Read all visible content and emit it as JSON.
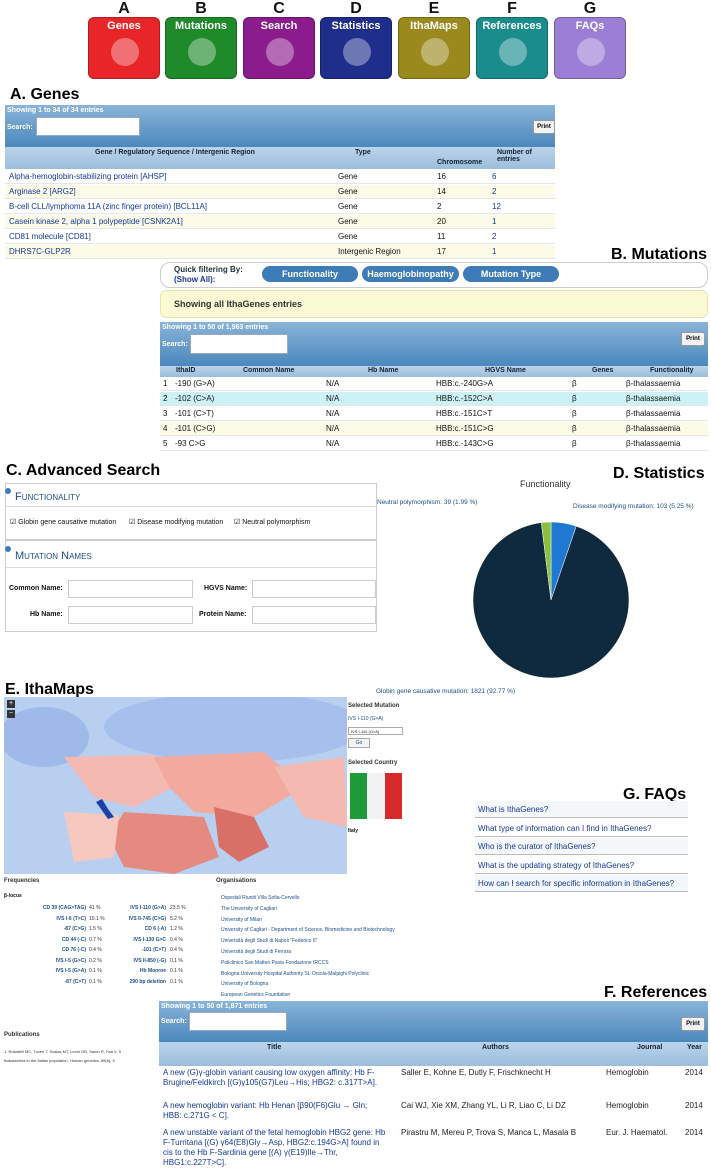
{
  "tiles": [
    {
      "letter": "A",
      "label": "Genes",
      "color": "#e8262a"
    },
    {
      "letter": "B",
      "label": "Mutations",
      "color": "#1f8a2a"
    },
    {
      "letter": "C",
      "label": "Search",
      "color": "#8b1c8c"
    },
    {
      "letter": "D",
      "label": "Statistics",
      "color": "#1e2e8a"
    },
    {
      "letter": "E",
      "label": "IthaMaps",
      "color": "#9a8a1e"
    },
    {
      "letter": "F",
      "label": "References",
      "color": "#1a8c8c"
    },
    {
      "letter": "G",
      "label": "FAQs",
      "color": "#9b7ed6"
    }
  ],
  "genes": {
    "title": "A. Genes",
    "info": "Showing 1 to 34 of 34 entries",
    "search_label": "Search:",
    "print": "Print",
    "headers": [
      "Gene / Regulatory Sequence / Intergenic Region",
      "Type",
      "Chromosome",
      "Number of entries"
    ],
    "rows": [
      [
        "Alpha-hemoglobin-stabilizing protein [AHSP]",
        "Gene",
        "16",
        "6"
      ],
      [
        "Arginase 2 [ARG2]",
        "Gene",
        "14",
        "2"
      ],
      [
        "B-cell CLL/lymphoma 11A (zinc finger protein) [BCL11A]",
        "Gene",
        "2",
        "12"
      ],
      [
        "Casein kinase 2, alpha 1 polypeptide [CSNK2A1]",
        "Gene",
        "20",
        "1"
      ],
      [
        "CD81 molecule [CD81]",
        "Gene",
        "11",
        "2"
      ],
      [
        "DHRS7C-GLP2R",
        "Intergenic Region",
        "17",
        "1"
      ]
    ]
  },
  "mutations": {
    "title": "B. Mutations",
    "quick_label": "Quick filtering By:",
    "show_all": "(Show All):",
    "filters": [
      "Functionality",
      "Haemoglobinopathy",
      "Mutation Type"
    ],
    "notice": "Showing all IthaGenes entries",
    "info": "Showing 1 to 50 of 1,963 entries",
    "search_label": "Search:",
    "print": "Print",
    "headers": [
      "IthaID",
      "Common Name",
      "Hb Name",
      "HGVS Name",
      "Genes",
      "Functionality"
    ],
    "rows": [
      [
        "1",
        "-190 (G>A)",
        "N/A",
        "HBB:c.-240G>A",
        "β",
        "β-thalassaemia"
      ],
      [
        "2",
        "-102 (C>A)",
        "N/A",
        "HBB:c.-152C>A",
        "β",
        "β-thalassaemia"
      ],
      [
        "3",
        "-101 (C>T)",
        "N/A",
        "HBB:c.-151C>T",
        "β",
        "β-thalassaemia"
      ],
      [
        "4",
        "-101 (C>G)",
        "N/A",
        "HBB:c.-151C>G",
        "β",
        "β-thalassaemia"
      ],
      [
        "5",
        "-93 C>G",
        "N/A",
        "HBB:c.-143C>G",
        "β",
        "β-thalassaemia"
      ]
    ]
  },
  "search": {
    "title": "C. Advanced Search",
    "functionality": "Functionality",
    "checks": [
      "Globin gene causative mutation",
      "Disease modifying mutation",
      "Neutral polymorphism"
    ],
    "mutation_names": "Mutation Names",
    "fields": [
      "Common Name:",
      "HGVS Name:",
      "Hb Name:",
      "Protein Name:"
    ]
  },
  "stats": {
    "title": "D. Statistics",
    "chart_title": "Functionality"
  },
  "chart_data": {
    "type": "pie",
    "title": "Functionality",
    "categories": [
      "Globin gene causative mutation",
      "Disease modifying mutation",
      "Neutral polymorphism"
    ],
    "values": [
      1821,
      103,
      39
    ],
    "percents": [
      92.77,
      5.25,
      1.99
    ],
    "colors": [
      "#0f2a3f",
      "#1f78d1",
      "#8cbf3f"
    ],
    "labels": [
      "Globin gene causative mutation: 1821 (92.77 %)",
      "Disease modifying mutation: 103 (5.25 %)",
      "Neutral polymorphism: 39 (1.99 %)"
    ]
  },
  "maps": {
    "title": "E. IthaMaps",
    "selected_mutation": "Selected Mutation",
    "mutation_value": "IVS I-110 (G>A)",
    "select_value": "IVS I-110 (G>A)",
    "go": "Go",
    "selected_country": "Selected Country",
    "country": "Italy",
    "frequencies": "Frequencies",
    "locus": "β-locus",
    "organisations": "Organisations",
    "freq_left": [
      [
        "CD 39 (CAG>TAG)",
        "41 %"
      ],
      [
        "IVS I-6 (T>C)",
        "10.1 %"
      ],
      [
        "-87 (C>G)",
        "1.5 %"
      ],
      [
        "CD 44 (-C)",
        "0.7 %"
      ],
      [
        "CD 76 (-C)",
        "0.4 %"
      ],
      [
        "IVS I-5 (G>C)",
        "0.2 %"
      ],
      [
        "IVS I-5 (G>A)",
        "0.1 %"
      ],
      [
        "-87 (C>T)",
        "0.1 %"
      ]
    ],
    "freq_right": [
      [
        "IVS I-110 (G>A)",
        "23.5 %"
      ],
      [
        "IVS II-745 (C>G)",
        "5.2 %"
      ],
      [
        "CD 6 (-A)",
        "1.2 %"
      ],
      [
        "IVS I-130 G>C",
        "0.4 %"
      ],
      [
        "-101 (C>T)",
        "0.4 %"
      ],
      [
        "IVS II-850 (-G)",
        "0.1 %"
      ],
      [
        "Hb Monroe",
        "0.1 %"
      ],
      [
        "290 bp deletion",
        "0.1 %"
      ]
    ],
    "orgs": [
      "Ospedali Riuniti Villa Sofia-Cervello",
      "The University of Cagliari",
      "University of Milan",
      "University of Cagliari - Department of Science, Biomedicine and Biotechnology",
      "Università degli Studi di Napoli \"Federico II\"",
      "Università degli Studi di Ferrara",
      "Policlinico San Matteo Pavia Fondazione IRCCS",
      "Bologna University Hospital Authority St. Orsola-Malpighi Polyclinic",
      "University of Bologna",
      "European Genetics Foundation"
    ],
    "publications": "Publications",
    "pub1": "1. Rosatelli MC, Tuveri T, Scalas MT, Leoni GB, Sardu R, Faà V, S",
    "pub2": "thalassemia in the Italian population. Human genetics, 89(6), 5"
  },
  "faqs": {
    "title": "G. FAQs",
    "items": [
      "What is IthaGenes?",
      "What type of information can I find in IthaGenes?",
      "Who is the curator of IthaGenes?",
      "What is the updating strategy of IthaGenes?",
      "How can I search for specific information in IthaGenes?"
    ]
  },
  "references": {
    "title": "F. References",
    "info": "Showing 1 to 50 of 1,871 entries",
    "search_label": "Search:",
    "print": "Print",
    "headers": [
      "Title",
      "Authors",
      "Journal",
      "Year"
    ],
    "rows": [
      {
        "title": "A new (G)γ-globin variant causing low oxygen affinity: Hb F-Brugine/Feldkirch [(G)γ105(G7)Leu→His; HBG2: c.317T>A].",
        "authors": "Saller E, Kohne E, Dutly F, Frischknecht H",
        "journal": "Hemoglobin",
        "year": "2014"
      },
      {
        "title": "A new hemoglobin variant: Hb Henan [β90(F6)Glu → Gln; HBB: c.271G < C].",
        "authors": "Cai WJ, Xie XM, Zhang YL, Li R, Liao C, Li DZ",
        "journal": "Hemoglobin",
        "year": "2014"
      },
      {
        "title": "A new unstable variant of the fetal hemoglobin HBG2 gene: Hb F-Turritana [(G) γ64(E8)Gly→Asp, HBG2:c.194G>A] found in cis to the Hb F-Sardinia gene [(A) γ(E19)Ile→Thr, HBG1:c.227T>C].",
        "authors": "Pirastru M, Mereu P, Trova S, Manca L, Masala B",
        "journal": "Eur. J. Haematol.",
        "year": "2014"
      }
    ]
  }
}
